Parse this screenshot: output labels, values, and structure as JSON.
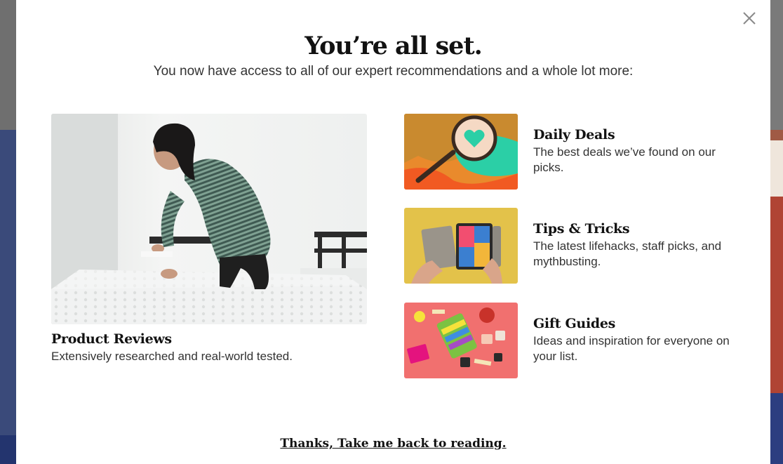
{
  "modal": {
    "title": "You’re all set.",
    "subtitle": "You now have access to all of our expert recommendations and a whole lot more:",
    "close_icon": "close-icon"
  },
  "hero": {
    "title": "Product Reviews",
    "description": "Extensively researched and real-world tested.",
    "image": "woman-making-bed-photo"
  },
  "features": [
    {
      "title": "Daily Deals",
      "description": "The best deals we’ve found on our picks.",
      "image": "magnifying-glass-heart-illustration"
    },
    {
      "title": "Tips & Tricks",
      "description": "The latest lifehacks, staff picks, and mythbusting.",
      "image": "tablet-in-hands-photo"
    },
    {
      "title": "Gift Guides",
      "description": "Ideas and inspiration for everyone on your list.",
      "image": "gift-items-flatlay-photo"
    }
  ],
  "back_link": "Thanks, Take me back to reading.",
  "colors": {
    "text": "#121212",
    "body_text": "#333333",
    "deals_orange": "#e98a2c",
    "deals_teal": "#2bcfa6",
    "tips_yellow": "#e3c24a",
    "gifts_pink": "#f1706f"
  }
}
